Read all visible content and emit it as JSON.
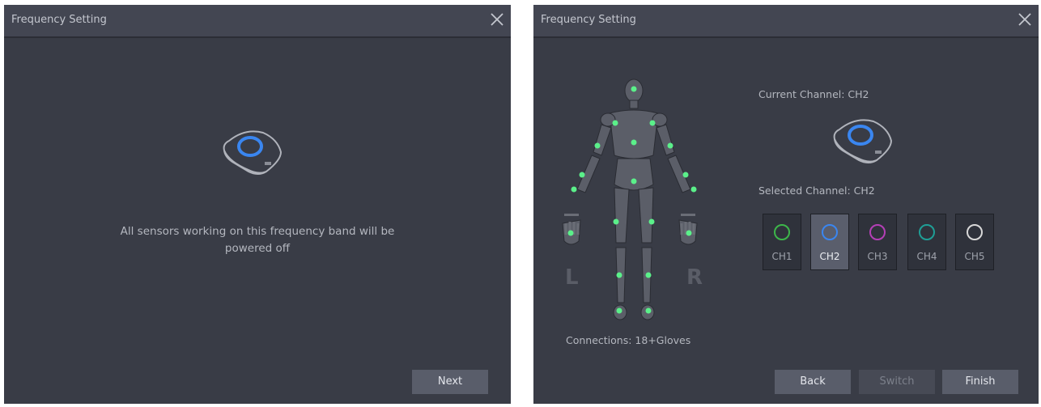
{
  "left_dialog": {
    "title": "Frequency Setting",
    "message": "All sensors working on this frequency band will be powered off",
    "next_label": "Next",
    "device_icon": "sensor-device-icon"
  },
  "right_dialog": {
    "title": "Frequency Setting",
    "current_channel": "Current Channel: CH2",
    "selected_channel": "Selected Channel: CH2",
    "connections": "Connections: 18+Gloves",
    "left_side": "L",
    "right_side": "R",
    "channels": [
      {
        "label": "CH1",
        "color": "#3db64a",
        "selected": false
      },
      {
        "label": "CH2",
        "color": "#3a86f0",
        "selected": true
      },
      {
        "label": "CH3",
        "color": "#b43fb6",
        "selected": false
      },
      {
        "label": "CH4",
        "color": "#1f9e96",
        "selected": false
      },
      {
        "label": "CH5",
        "color": "#d8d8d8",
        "selected": false
      }
    ],
    "back_label": "Back",
    "switch_label": "Switch",
    "finish_label": "Finish",
    "device_icon": "sensor-device-icon",
    "body_icon": "body-figure-icon"
  },
  "colors": {
    "dialog_bg": "#393c46",
    "titlebar_bg": "#434652",
    "sensor_dot": "#5bf08a",
    "device_ring": "#3a86f0"
  }
}
